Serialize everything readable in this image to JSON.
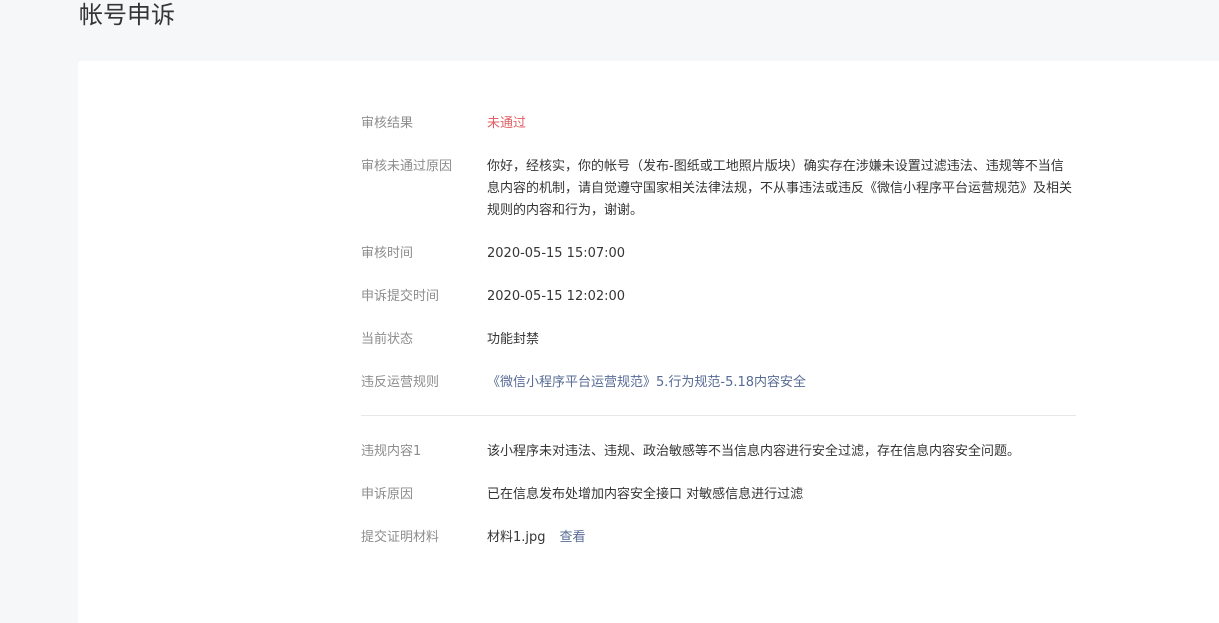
{
  "page": {
    "title": "帐号申诉"
  },
  "review": {
    "result": {
      "label": "审核结果",
      "value": "未通过",
      "status_color": "#e15f63"
    },
    "reason": {
      "label": "审核未通过原因",
      "value": "你好，经核实，你的帐号（发布-图纸或工地照片版块）确实存在涉嫌未设置过滤违法、违规等不当信息内容的机制，请自觉遵守国家相关法律法规，不从事违法或违反《微信小程序平台运营规范》及相关规则的内容和行为，谢谢。"
    },
    "review_time": {
      "label": "审核时间",
      "value": "2020-05-15 15:07:00"
    },
    "submit_time": {
      "label": "申诉提交时间",
      "value": "2020-05-15 12:02:00"
    },
    "current_status": {
      "label": "当前状态",
      "value": "功能封禁"
    },
    "violated_rule": {
      "label": "违反运营规则",
      "value": "《微信小程序平台运营规范》5.行为规范-5.18内容安全",
      "link_color": "#576b95"
    }
  },
  "appeal": {
    "violation_content": {
      "label": "违规内容1",
      "value": "该小程序未对违法、违规、政治敏感等不当信息内容进行安全过滤，存在信息内容安全问题。"
    },
    "appeal_reason": {
      "label": "申诉原因",
      "value": "已在信息发布处增加内容安全接口 对敏感信息进行过滤"
    },
    "evidence": {
      "label": "提交证明材料",
      "file_name": "材料1.jpg",
      "view_label": "查看"
    }
  }
}
